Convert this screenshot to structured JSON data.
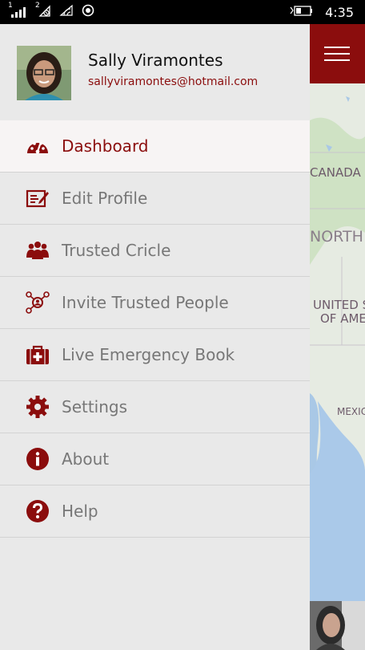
{
  "status_bar": {
    "time": "4:35",
    "sim1_label": "1",
    "sim2_label": "2",
    "icons": [
      "signal-icon",
      "signal-2-icon",
      "wifi-icon",
      "location-icon",
      "battery-icon"
    ]
  },
  "user": {
    "name": "Sally Viramontes",
    "email": "sallyviramontes@hotmail.com"
  },
  "menu": {
    "items": [
      {
        "label": "Dashboard",
        "icon": "dashboard-icon",
        "active": true
      },
      {
        "label": "Edit Profile",
        "icon": "edit-profile-icon",
        "active": false
      },
      {
        "label": "Trusted Cricle",
        "icon": "people-group-icon",
        "active": false
      },
      {
        "label": "Invite Trusted People",
        "icon": "invite-network-icon",
        "active": false
      },
      {
        "label": "Live Emergency Book",
        "icon": "first-aid-kit-icon",
        "active": false
      },
      {
        "label": "Settings",
        "icon": "gear-icon",
        "active": false
      },
      {
        "label": "About",
        "icon": "info-icon",
        "active": false
      },
      {
        "label": "Help",
        "icon": "help-icon",
        "active": false
      }
    ]
  },
  "map": {
    "labels": [
      "CANADA",
      "NORTH A",
      "UNITED S",
      "OF AME",
      "MEXICO"
    ]
  },
  "colors": {
    "accent": "#8b0d0d",
    "drawer_bg": "#e9e9e9",
    "active_item_bg": "#f7f4f4",
    "label_text": "#777777"
  }
}
